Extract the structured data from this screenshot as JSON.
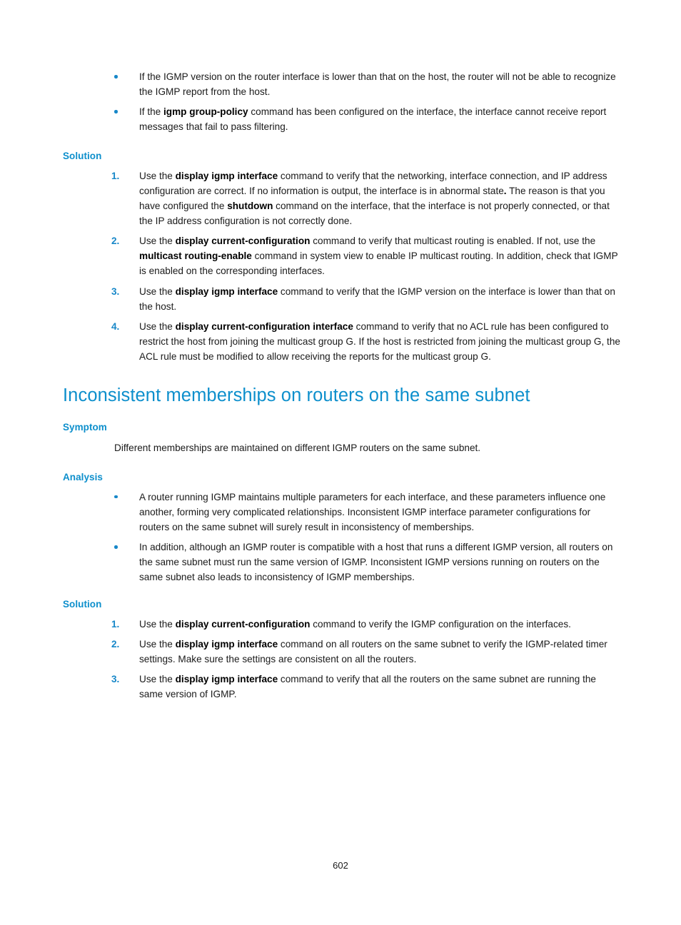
{
  "document": {
    "page_number": "602"
  },
  "sections": [
    {
      "id": "analysis-continued",
      "bullets": [
        {
          "parts": [
            {
              "text": "If the IGMP version on the router interface is lower than that on the host, the router will not be able to recognize the IGMP report from the host.",
              "bold": false
            }
          ]
        },
        {
          "parts": [
            {
              "text": "If the ",
              "bold": false
            },
            {
              "text": "igmp group-policy",
              "bold": true
            },
            {
              "text": " command has been configured on the interface, the interface cannot receive report messages that fail to pass filtering.",
              "bold": false
            }
          ]
        }
      ]
    },
    {
      "id": "solution-1",
      "heading": "Solution",
      "items": [
        {
          "marker": "1.",
          "parts": [
            {
              "text": "Use the ",
              "bold": false
            },
            {
              "text": "display igmp interface",
              "bold": true
            },
            {
              "text": " command to verify that the networking, interface connection, and IP address configuration are correct. If no information is output, the interface is in abnormal state",
              "bold": false
            },
            {
              "text": ".",
              "bold": true
            },
            {
              "text": " The reason is that you have configured the ",
              "bold": false
            },
            {
              "text": "shutdown",
              "bold": true
            },
            {
              "text": " command on the interface, that the interface is not properly connected, or that the IP address configuration is not correctly done.",
              "bold": false
            }
          ]
        },
        {
          "marker": "2.",
          "parts": [
            {
              "text": "Use the ",
              "bold": false
            },
            {
              "text": "display current-configuration",
              "bold": true
            },
            {
              "text": " command to verify that multicast routing is enabled. If not, use the ",
              "bold": false
            },
            {
              "text": "multicast routing-enable",
              "bold": true
            },
            {
              "text": " command in system view to enable IP multicast routing. In addition, check that IGMP is enabled on the corresponding interfaces.",
              "bold": false
            }
          ]
        },
        {
          "marker": "3.",
          "parts": [
            {
              "text": "Use the ",
              "bold": false
            },
            {
              "text": "display igmp interface",
              "bold": true
            },
            {
              "text": " command to verify that the IGMP version on the interface is lower than that on the host.",
              "bold": false
            }
          ]
        },
        {
          "marker": "4.",
          "parts": [
            {
              "text": "Use the ",
              "bold": false
            },
            {
              "text": "display current-configuration interface",
              "bold": true
            },
            {
              "text": " command to verify that no ACL rule has been configured to restrict the host from joining the multicast group G. If the host is restricted from joining the multicast group G, the ACL rule must be modified to allow receiving the reports for the multicast group G.",
              "bold": false
            }
          ]
        }
      ]
    },
    {
      "id": "chapter",
      "title": "Inconsistent memberships on routers on the same subnet"
    },
    {
      "id": "symptom",
      "heading": "Symptom",
      "paragraph": "Different memberships are maintained on different IGMP routers on the same subnet."
    },
    {
      "id": "analysis",
      "heading": "Analysis",
      "bullets": [
        {
          "parts": [
            {
              "text": "A router running IGMP maintains multiple parameters for each interface, and these parameters influence one another, forming very complicated relationships. Inconsistent IGMP interface parameter configurations for routers on the same subnet will surely result in inconsistency of memberships.",
              "bold": false
            }
          ]
        },
        {
          "parts": [
            {
              "text": "In addition, although an IGMP router is compatible with a host that runs a different IGMP version, all routers on the same subnet must run the same version of IGMP. Inconsistent IGMP versions running on routers on the same subnet also leads to inconsistency of IGMP memberships.",
              "bold": false
            }
          ]
        }
      ]
    },
    {
      "id": "solution-2",
      "heading": "Solution",
      "items": [
        {
          "marker": "1.",
          "parts": [
            {
              "text": "Use the ",
              "bold": false
            },
            {
              "text": "display current-configuration",
              "bold": true
            },
            {
              "text": " command to verify the IGMP configuration on the interfaces.",
              "bold": false
            }
          ]
        },
        {
          "marker": "2.",
          "parts": [
            {
              "text": "Use the ",
              "bold": false
            },
            {
              "text": "display igmp interface",
              "bold": true
            },
            {
              "text": " command on all routers on the same subnet to verify the IGMP-related timer settings. Make sure the settings are consistent on all the routers.",
              "bold": false
            }
          ]
        },
        {
          "marker": "3.",
          "parts": [
            {
              "text": "Use the ",
              "bold": false
            },
            {
              "text": "display igmp interface",
              "bold": true
            },
            {
              "text": " command to verify that all the routers on the same subnet are running the same version of IGMP.",
              "bold": false
            }
          ]
        }
      ]
    }
  ]
}
